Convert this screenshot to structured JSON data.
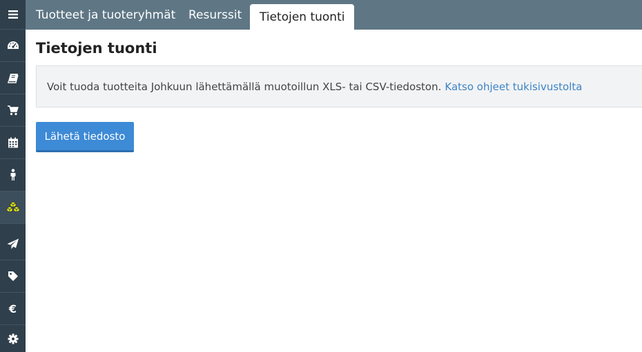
{
  "sidebar": {
    "items": [
      {
        "icon": "menu-icon"
      },
      {
        "icon": "dashboard-icon"
      },
      {
        "icon": "book-icon"
      },
      {
        "icon": "cart-icon"
      },
      {
        "icon": "calendar-icon"
      },
      {
        "icon": "person-icon"
      },
      {
        "icon": "cubes-icon",
        "active": true,
        "color": "#e8e800"
      },
      {
        "icon": "send-icon"
      },
      {
        "icon": "tag-icon"
      },
      {
        "icon": "euro-icon",
        "glyph": "€"
      },
      {
        "icon": "gear-icon"
      }
    ]
  },
  "tabs": [
    {
      "label": "Tuotteet ja tuoteryhmät"
    },
    {
      "label": "Resurssit"
    },
    {
      "label": "Tietojen tuonti",
      "active": true
    }
  ],
  "main": {
    "title": "Tietojen tuonti",
    "info_text": "Voit tuoda tuotteita Johkuun lähettämällä muotoillun XLS- tai CSV-tiedoston.",
    "info_link": "Katso ohjeet tukisivustolta",
    "upload_button": "Lähetä tiedosto"
  },
  "colors": {
    "sidebar_bg": "#2f3f4b",
    "tabbar_bg": "#5f7785",
    "primary_button": "#3d8ad6",
    "link": "#3d84c6",
    "active_icon": "#e8e800"
  }
}
